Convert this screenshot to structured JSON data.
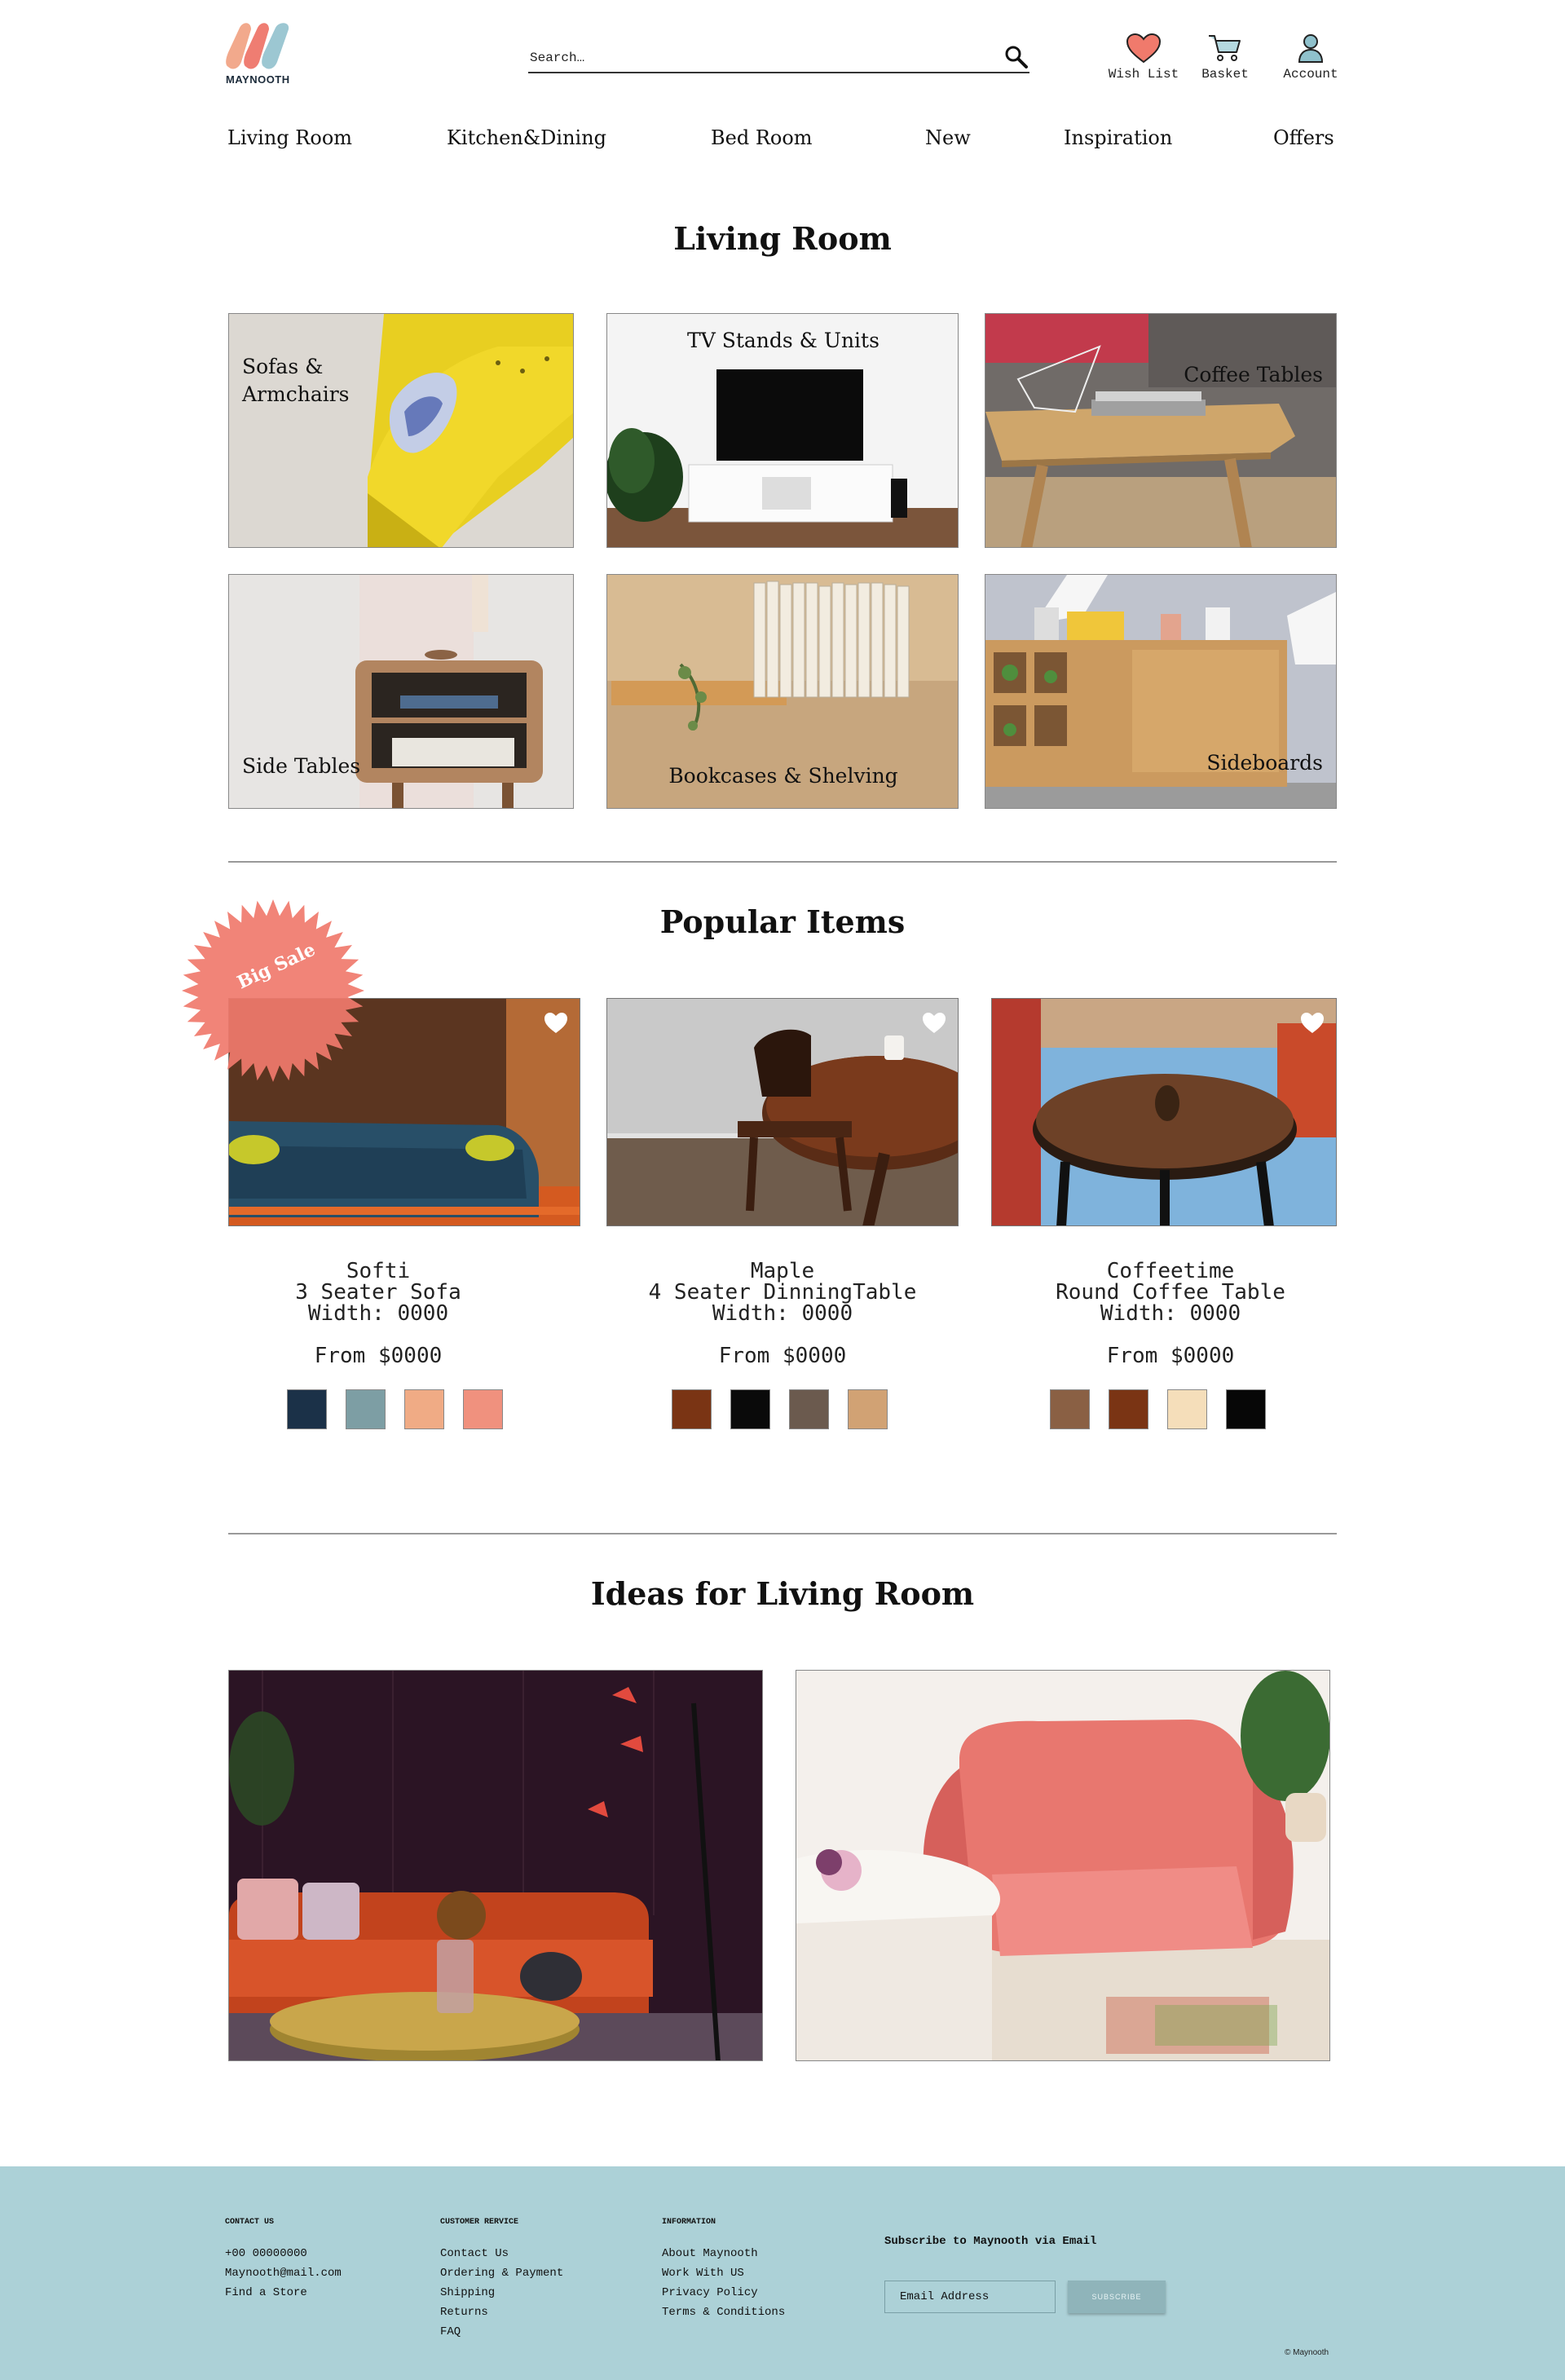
{
  "brand": {
    "name": "MAYNOOTH"
  },
  "header": {
    "search_placeholder": "Search…",
    "wishlist_label": "Wish List",
    "basket_label": "Basket",
    "account_label": "Account"
  },
  "nav": {
    "items": [
      {
        "label": "Living Room"
      },
      {
        "label": "Kitchen&Dining"
      },
      {
        "label": "Bed Room"
      },
      {
        "label": "New"
      },
      {
        "label": "Inspiration"
      },
      {
        "label": "Offers"
      }
    ]
  },
  "living_room": {
    "title": "Living Room",
    "categories": [
      {
        "label": "Sofas &\nArmchairs"
      },
      {
        "label": "TV Stands & Units"
      },
      {
        "label": "Coffee Tables"
      },
      {
        "label": "Side Tables"
      },
      {
        "label": "Bookcases & Shelving"
      },
      {
        "label": "Sideboards"
      }
    ]
  },
  "popular": {
    "title": "Popular Items",
    "sale_badge": "Big Sale",
    "products": [
      {
        "name": "Softi",
        "desc": "3 Seater Sofa",
        "width": "Width: 0000",
        "price": "From $0000",
        "swatches": [
          "#1b3148",
          "#7d9ea4",
          "#f0ab85",
          "#f0917e"
        ]
      },
      {
        "name": "Maple",
        "desc": "4 Seater DinningTable",
        "width": "Width: 0000",
        "price": "From $0000",
        "swatches": [
          "#7a3414",
          "#0a0a0a",
          "#6b5a4e",
          "#d1a274"
        ]
      },
      {
        "name": "Coffeetime",
        "desc": "Round Coffee Table",
        "width": "Width: 0000",
        "price": "From $0000",
        "swatches": [
          "#8a6044",
          "#7a3414",
          "#f5deba",
          "#070707"
        ]
      }
    ]
  },
  "ideas": {
    "title": "Ideas for Living Room"
  },
  "footer": {
    "contact": {
      "heading": "CONTACT US",
      "phone": "+00 00000000",
      "email": "Maynooth@mail.com",
      "store": "Find a Store"
    },
    "service": {
      "heading": "CUSTOMER RERVICE",
      "items": [
        "Contact Us",
        "Ordering & Payment",
        "Shipping",
        "Returns",
        "FAQ"
      ]
    },
    "info": {
      "heading": "INFORMATION",
      "items": [
        "About Maynooth",
        "Work With US",
        "Privacy Policy",
        "Terms & Conditions"
      ]
    },
    "subscribe": {
      "heading": "Subscribe to Maynooth via Email",
      "placeholder": "Email Address",
      "button": "SUBSCRIBE"
    },
    "copyright": "© Maynooth"
  },
  "colors": {
    "accent": "#f07a6c",
    "footer_bg": "#acd1d7"
  }
}
